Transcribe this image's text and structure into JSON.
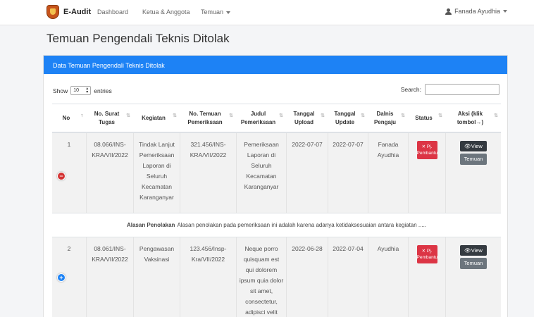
{
  "nav": {
    "brand": "E-Audit",
    "links": [
      "Dashboard",
      "Ketua & Anggota",
      "Temuan"
    ],
    "user": "Fanada Ayudhia"
  },
  "page_title": "Temuan Pengendali Teknis Ditolak",
  "card_title": "Data Temuan Pengendali Teknis Ditolak",
  "length": {
    "prefix": "Show",
    "value": "10",
    "suffix": "entries"
  },
  "search_label": "Search:",
  "headers": [
    "No",
    "No. Surat Tugas",
    "Kegiatan",
    "No. Temuan Pemeriksaan",
    "Judul Pemeriksaan",
    "Tanggal Upload",
    "Tanggal Update",
    "Dalnis Pengaju",
    "Status",
    "Aksi (klik tombol→)"
  ],
  "rows": [
    {
      "no": "1",
      "surat": "08.066/INS-KRA/VII/2022",
      "kegiatan": "Tindak Lanjut Pemeriksaan Laporan di Seluruh Kecamatan Karanganyar",
      "temuan": "321.456/INS-KRA/VII/2022",
      "judul": "Pemeriksaan Laporan di Seluruh Kecamatan Karanganyar",
      "upload": "2022-07-07",
      "update": "2022-07-07",
      "dalnis": "Fanada Ayudhia",
      "status": "✕ Pj. Pembantu",
      "expanded": true,
      "reason_label": "Alasan Penolakan",
      "reason": "Alasan penolakan pada pemeriksaan ini adalah karena adanya ketidaksesuaian antara kegiatan ....."
    },
    {
      "no": "2",
      "surat": "08.061/INS-KRA/VII/2022",
      "kegiatan": "Pengawasan Vaksinasi",
      "temuan": "123.456/Insp-Kra/VII/2022",
      "judul": "Neque porro quisquam est qui dolorem ipsum quia dolor sit amet, consectetur, adipisci velit",
      "upload": "2022-06-28",
      "update": "2022-07-04",
      "dalnis": "Ayudhia",
      "status": "✕ Pj. Pembantu",
      "expanded": false
    }
  ],
  "actions": {
    "view": "View",
    "temuan": "Temuan"
  },
  "colors": {
    "primary": "#1d82f5",
    "danger": "#dc3545",
    "dark": "#343a40",
    "secondary": "#6c757d"
  },
  "icons": {
    "logo": "crest-logo",
    "user": "user-icon",
    "view": "eye-icon",
    "expand": "plus-circle-icon",
    "collapse": "minus-circle-icon"
  }
}
